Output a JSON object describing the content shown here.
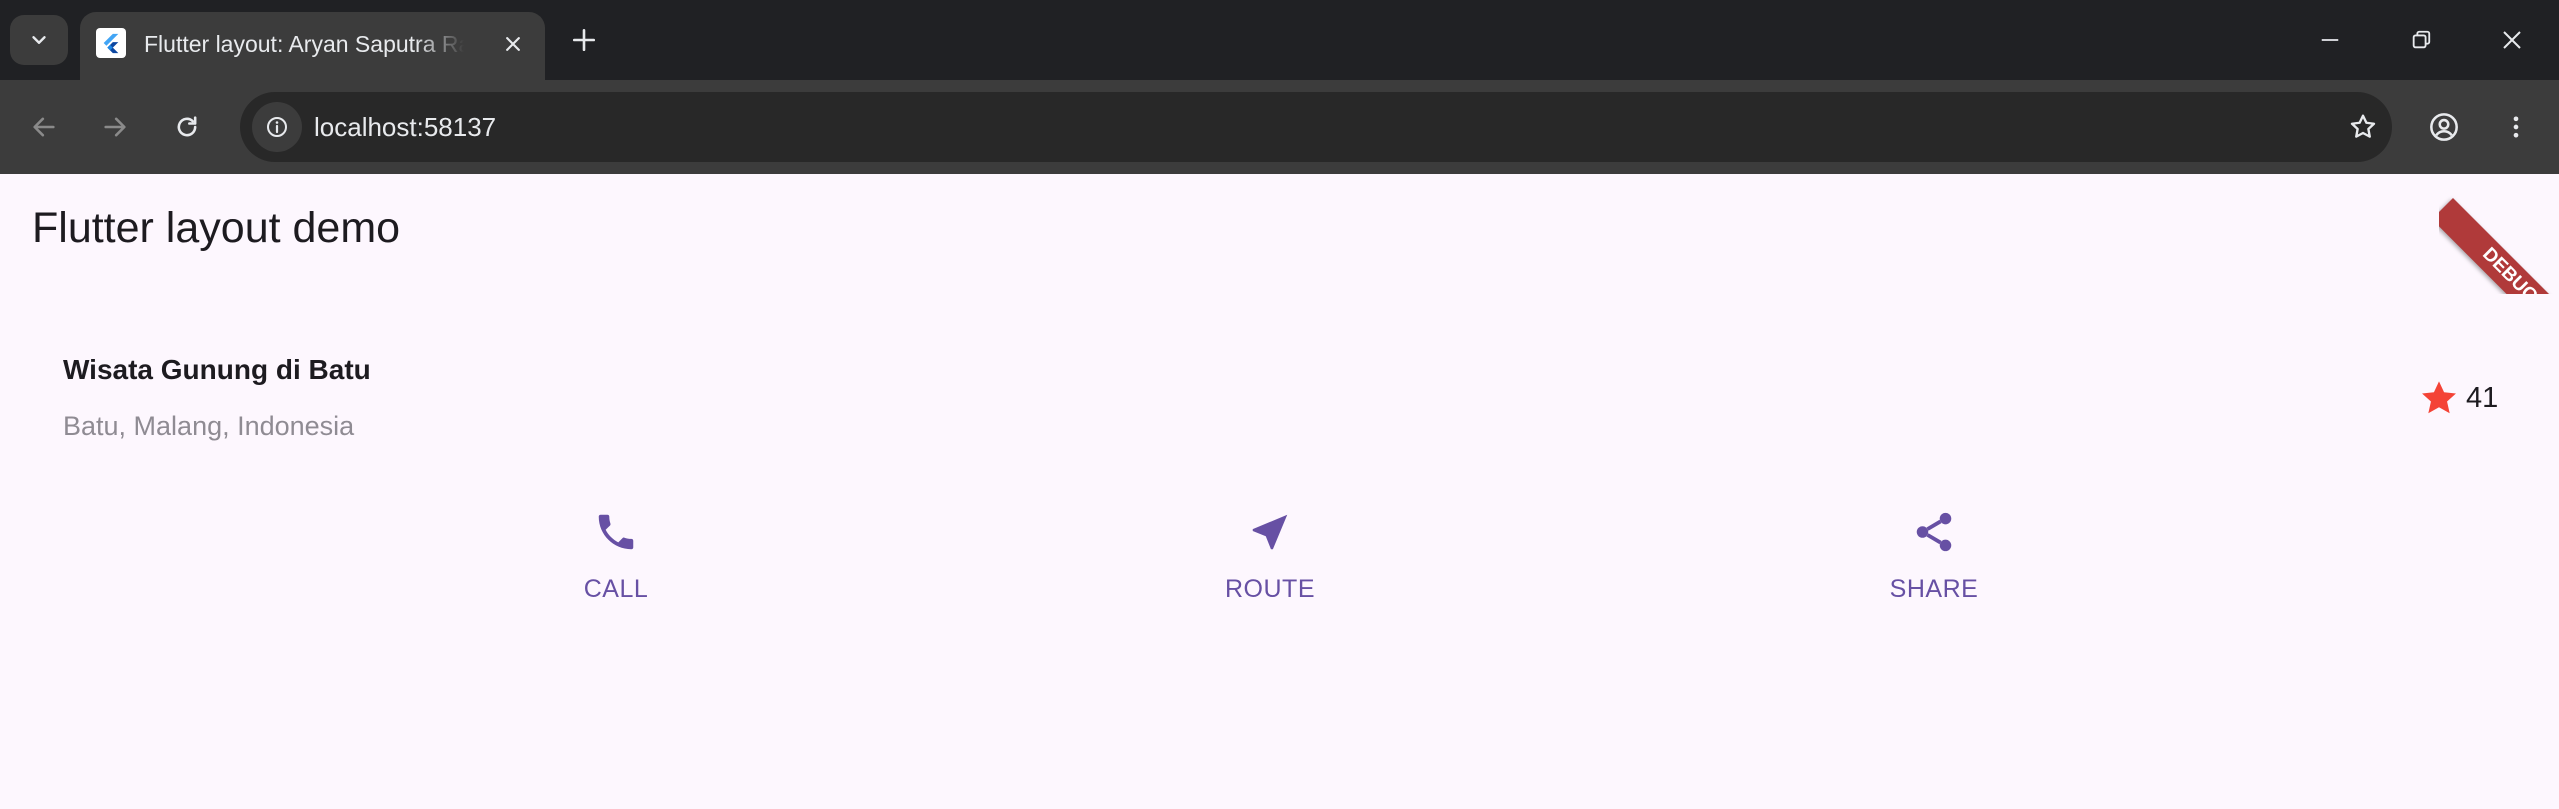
{
  "browser": {
    "tab": {
      "title": "Flutter layout: Aryan Saputra Ra"
    },
    "address_bar": {
      "url": "localhost:58137"
    },
    "colors": {
      "tab_strip": "#202124",
      "toolbar": "#3c3c3c",
      "omnibox": "#282828"
    }
  },
  "app": {
    "appbar_title": "Flutter layout demo",
    "place": {
      "title": "Wisata Gunung di Batu",
      "subtitle": "Batu, Malang, Indonesia"
    },
    "rating": {
      "icon": "star-icon",
      "count": "41"
    },
    "actions": [
      {
        "icon": "phone-icon",
        "label": "CALL"
      },
      {
        "icon": "navigation-icon",
        "label": "ROUTE"
      },
      {
        "icon": "share-icon",
        "label": "SHARE"
      }
    ],
    "debug_banner": "DEBUG",
    "colors": {
      "background": "#fdf7fe",
      "primary": "#6750a4",
      "star": "#f44336",
      "subtitle": "#8f8b93",
      "debug": "#b03a3a"
    }
  }
}
